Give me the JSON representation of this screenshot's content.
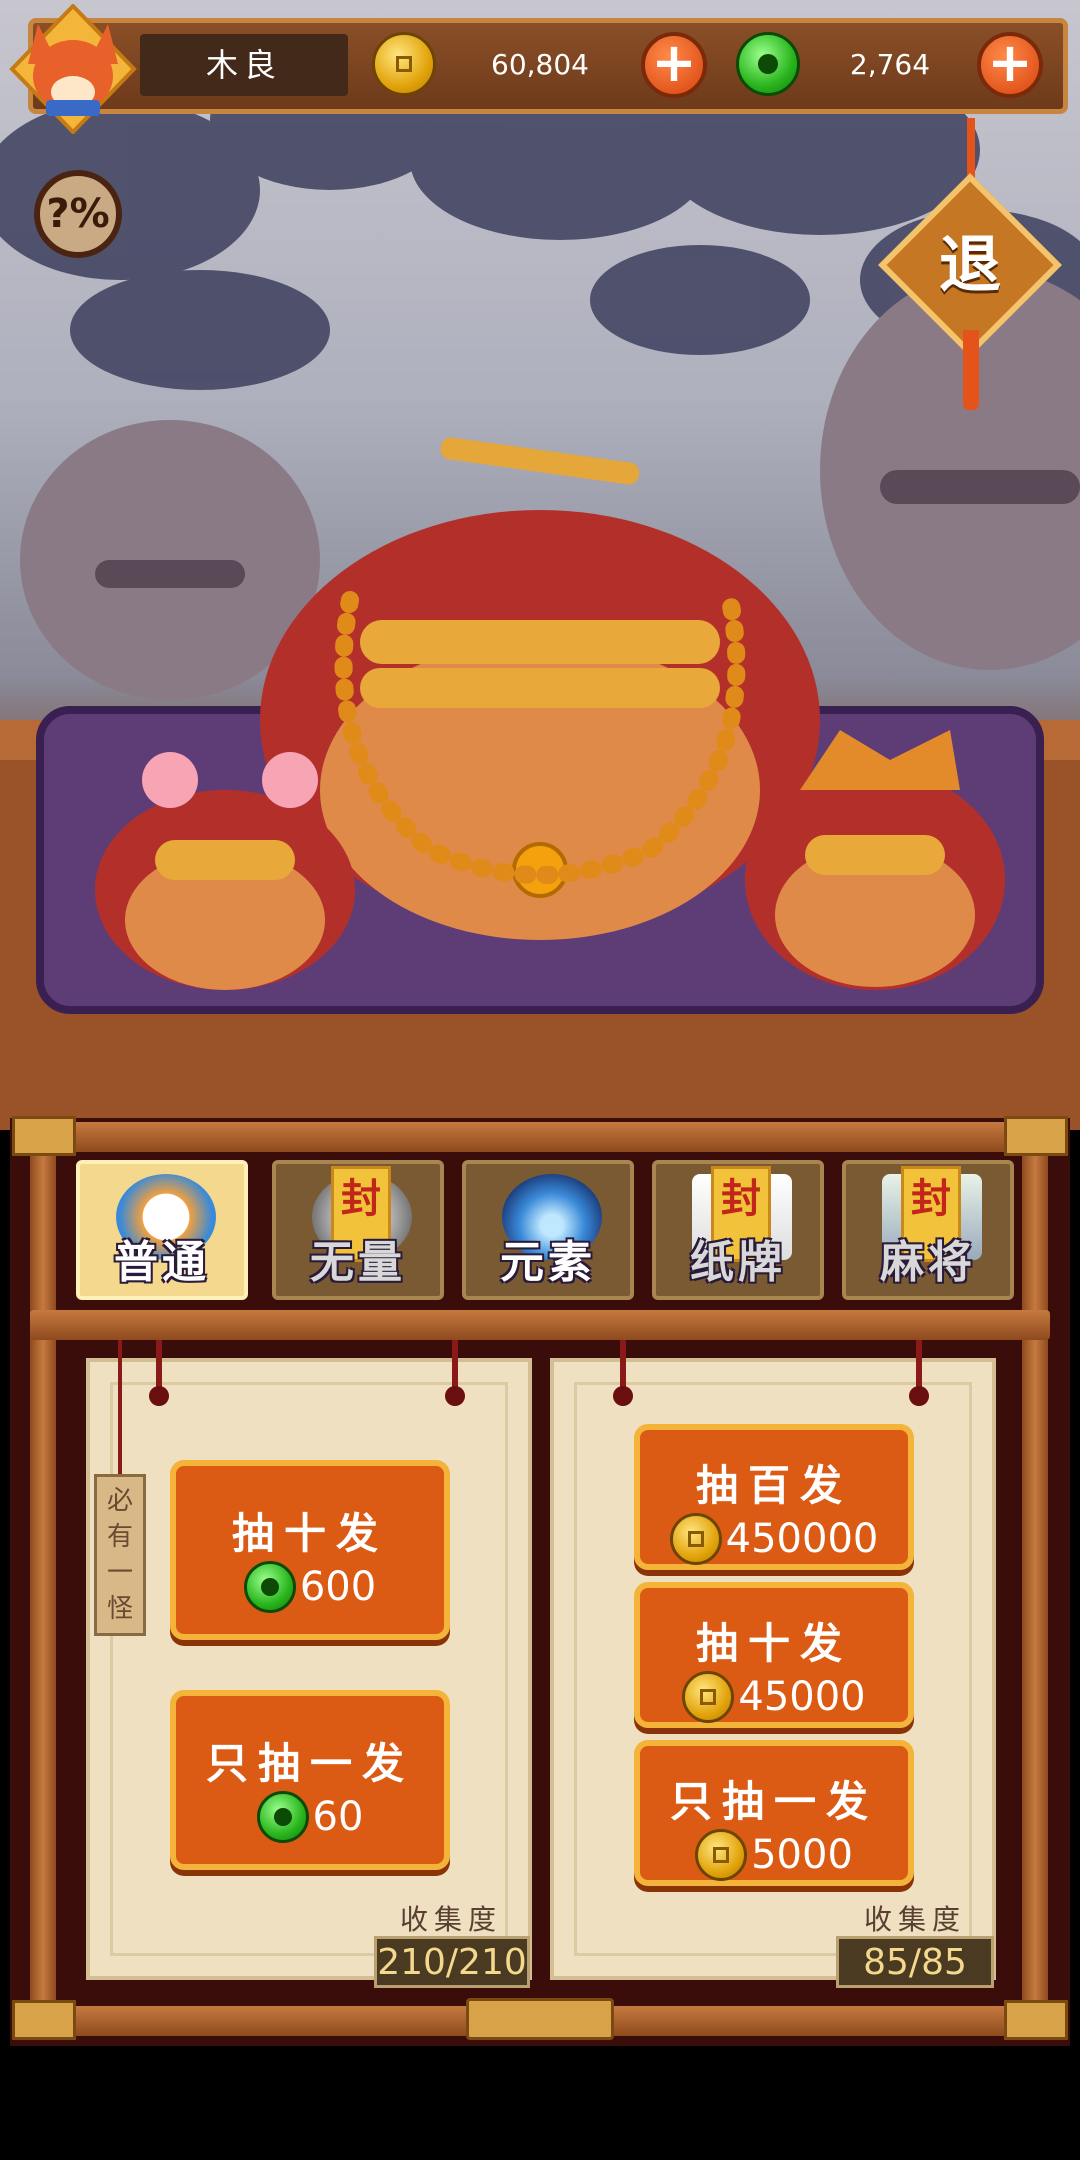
{
  "hud": {
    "player_name": "木良",
    "coins": "60,804",
    "jade": "2,764",
    "plus_label": "+"
  },
  "help": {
    "label": "?%"
  },
  "exit": {
    "label": "退"
  },
  "tabs": [
    {
      "label": "普通",
      "active": true,
      "locked": false
    },
    {
      "label": "无量",
      "active": false,
      "locked": true
    },
    {
      "label": "元素",
      "active": false,
      "locked": false
    },
    {
      "label": "纸牌",
      "active": false,
      "locked": true
    },
    {
      "label": "麻将",
      "active": false,
      "locked": true
    }
  ],
  "seal_char": "封",
  "left_scroll": {
    "tag": "必有一怪",
    "buttons": [
      {
        "title": "抽十发",
        "currency": "jade",
        "price": "600"
      },
      {
        "title": "只抽一发",
        "currency": "jade",
        "price": "60"
      }
    ],
    "collection_label": "收集度",
    "collection_value": "210/210"
  },
  "right_scroll": {
    "buttons": [
      {
        "title": "抽百发",
        "currency": "gold",
        "price": "450000"
      },
      {
        "title": "抽十发",
        "currency": "gold",
        "price": "45000"
      },
      {
        "title": "只抽一发",
        "currency": "gold",
        "price": "5000"
      }
    ],
    "collection_label": "收集度",
    "collection_value": "85/85"
  },
  "colors": {
    "accent": "#dc5b14",
    "gold": "#e2a40c",
    "jade": "#29b51d",
    "panel": "#3a0d0a"
  }
}
